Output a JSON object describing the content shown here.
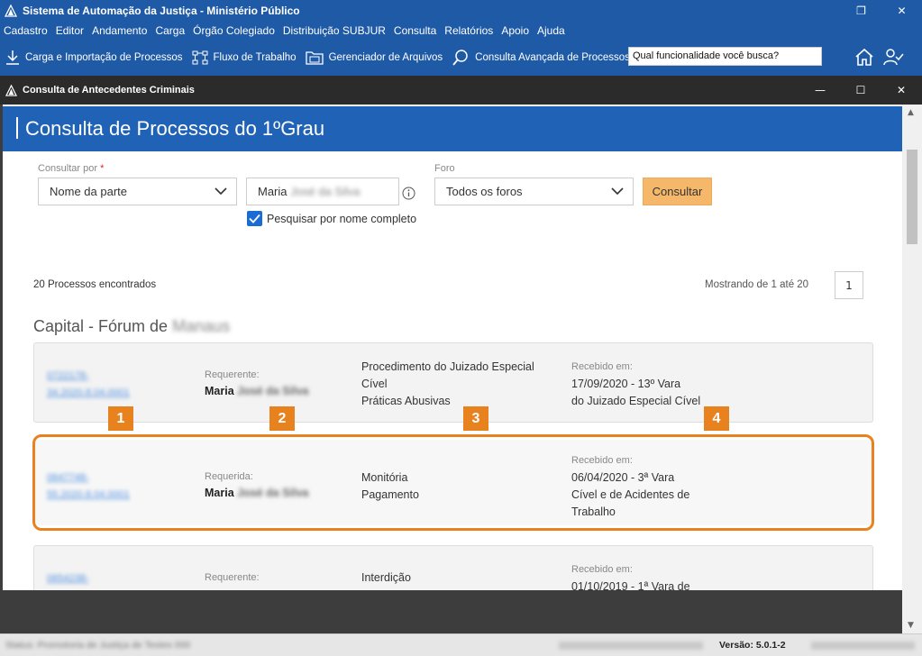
{
  "app": {
    "title": "Sistema de Automação da Justiça - Ministério Público",
    "window_controls": {
      "restore": "❐",
      "close": "✕"
    }
  },
  "menu": [
    "Cadastro",
    "Editor",
    "Andamento",
    "Carga",
    "Órgão Colegiado",
    "Distribuição SUBJUR",
    "Consulta",
    "Relatórios",
    "Apoio",
    "Ajuda"
  ],
  "toolbar": {
    "items": [
      {
        "label": "Carga e Importação de Processos",
        "icon": "download-icon"
      },
      {
        "label": "Fluxo de Trabalho",
        "icon": "workflow-icon"
      },
      {
        "label": "Gerenciador de Arquivos",
        "icon": "folder-icon"
      },
      {
        "label": "Consulta Avançada de Processos",
        "icon": "search-icon"
      }
    ],
    "search_value": "Qual funcionalidade você busca?"
  },
  "inner_window": {
    "title": "Consulta de Antecedentes Criminais",
    "controls": {
      "minimize": "—",
      "maximize": "☐",
      "close": "✕"
    }
  },
  "page": {
    "title": "Consulta de Processos do 1ºGrau",
    "consultar_por_label": "Consultar por",
    "required_mark": "*",
    "consultar_por_value": "Nome da parte",
    "name_value": "Maria",
    "name_value_blurred": "José da Silva",
    "foro_label": "Foro",
    "foro_value": "Todos os foros",
    "consultar_button": "Consultar",
    "checkbox_label": "Pesquisar por nome completo",
    "result_count": "20 Processos encontrados",
    "showing": "Mostrando de 1 até 20",
    "page_number": "1",
    "group_title": "Capital - Fórum de",
    "group_title_blurred": "Manaus"
  },
  "results": [
    {
      "link1": "0722178-",
      "link2": "34.2020.8.04.0001",
      "role": "Requerente:",
      "name": "Maria",
      "name_blurred": "José da Silva",
      "desc": [
        "Procedimento do Juizado Especial",
        "Cível",
        "Práticas Abusivas"
      ],
      "recv_label": "Recebido em:",
      "recv": [
        "17/09/2020 - 13º Vara",
        "do Juizado Especial Cível"
      ]
    },
    {
      "link1": "0647748-",
      "link2": "55.2020.8.04.0001",
      "role": "Requerida:",
      "name": "Maria",
      "name_blurred": "José da Silva",
      "desc": [
        "Monitória",
        "Pagamento"
      ],
      "recv_label": "Recebido em:",
      "recv": [
        "06/04/2020 - 3ª Vara",
        "Cível e de Acidentes de",
        "Trabalho"
      ]
    },
    {
      "link1": "0654238-",
      "link2": "",
      "role": "Requerente:",
      "name": "",
      "name_blurred": "",
      "desc": [
        "Interdição"
      ],
      "recv_label": "Recebido em:",
      "recv": [
        "01/10/2019 - 1ª Vara de"
      ]
    }
  ],
  "badges": [
    "1",
    "2",
    "3",
    "4"
  ],
  "status": {
    "left": "Status: Promotoria de Justiça de Testes 000",
    "version": "Versão: 5.0.1-2"
  },
  "colors": {
    "brand_blue": "#1f5aa6",
    "header_blue": "#1f62b6",
    "highlight_orange": "#e8821e",
    "button_orange": "#f5b86a",
    "link_blue": "#4f8fe0"
  }
}
